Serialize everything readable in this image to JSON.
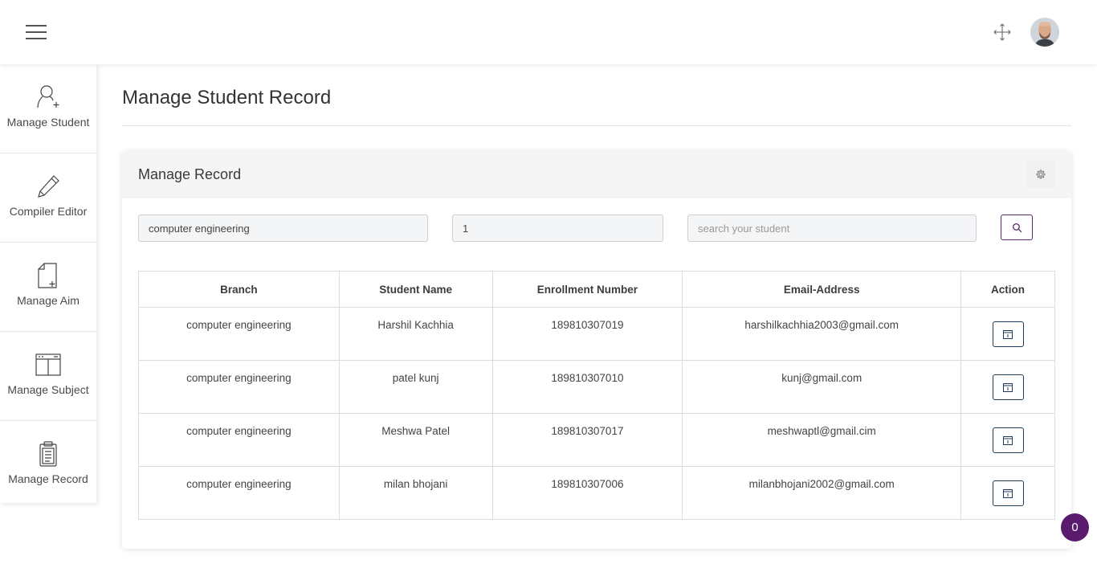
{
  "header": {
    "menu_icon": "hamburger-icon",
    "fullscreen_icon": "fullscreen-arrows-icon",
    "avatar_icon": "user-avatar"
  },
  "sidebar": {
    "items": [
      {
        "label": "Manage Student",
        "icon": "user-add-icon"
      },
      {
        "label": "Compiler Editor",
        "icon": "pencil-icon"
      },
      {
        "label": "Manage Aim",
        "icon": "file-add-icon"
      },
      {
        "label": "Manage Subject",
        "icon": "window-layout-icon"
      },
      {
        "label": "Manage Record",
        "icon": "clipboard-icon"
      }
    ]
  },
  "page": {
    "title": "Manage Student Record"
  },
  "card": {
    "title": "Manage Record",
    "settings_icon": "gear-icon"
  },
  "filters": {
    "branch_value": "computer engineering",
    "semester_value": "1",
    "search_value": "",
    "search_placeholder": "search your student",
    "search_icon": "search-icon"
  },
  "table": {
    "columns": [
      "Branch",
      "Student Name",
      "Enrollment Number",
      "Email-Address",
      "Action"
    ],
    "rows": [
      {
        "branch": "computer engineering",
        "name": "Harshil Kachhia",
        "enrollment": "189810307019",
        "email": "harshilkachhia2003@gmail.com"
      },
      {
        "branch": "computer engineering",
        "name": "patel kunj",
        "enrollment": "189810307010",
        "email": "kunj@gmail.com"
      },
      {
        "branch": "computer engineering",
        "name": "Meshwa Patel",
        "enrollment": "189810307017",
        "email": "meshwaptl@gmail.cim"
      },
      {
        "branch": "computer engineering",
        "name": "milan bhojani",
        "enrollment": "189810307006",
        "email": "milanbhojani2002@gmail.com"
      }
    ],
    "action_icon": "view-record-icon"
  },
  "notification": {
    "count": "0"
  },
  "colors": {
    "accent": "#5b1a6e",
    "action_border": "#1f3b5c",
    "card_header_bg": "#f5f5f5"
  }
}
